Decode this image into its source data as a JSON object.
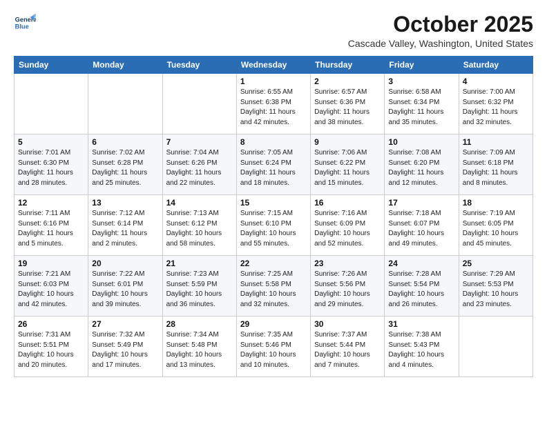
{
  "header": {
    "logo_line1": "General",
    "logo_line2": "Blue",
    "month": "October 2025",
    "location": "Cascade Valley, Washington, United States"
  },
  "weekdays": [
    "Sunday",
    "Monday",
    "Tuesday",
    "Wednesday",
    "Thursday",
    "Friday",
    "Saturday"
  ],
  "weeks": [
    [
      {
        "day": "",
        "text": ""
      },
      {
        "day": "",
        "text": ""
      },
      {
        "day": "",
        "text": ""
      },
      {
        "day": "1",
        "text": "Sunrise: 6:55 AM\nSunset: 6:38 PM\nDaylight: 11 hours\nand 42 minutes."
      },
      {
        "day": "2",
        "text": "Sunrise: 6:57 AM\nSunset: 6:36 PM\nDaylight: 11 hours\nand 38 minutes."
      },
      {
        "day": "3",
        "text": "Sunrise: 6:58 AM\nSunset: 6:34 PM\nDaylight: 11 hours\nand 35 minutes."
      },
      {
        "day": "4",
        "text": "Sunrise: 7:00 AM\nSunset: 6:32 PM\nDaylight: 11 hours\nand 32 minutes."
      }
    ],
    [
      {
        "day": "5",
        "text": "Sunrise: 7:01 AM\nSunset: 6:30 PM\nDaylight: 11 hours\nand 28 minutes."
      },
      {
        "day": "6",
        "text": "Sunrise: 7:02 AM\nSunset: 6:28 PM\nDaylight: 11 hours\nand 25 minutes."
      },
      {
        "day": "7",
        "text": "Sunrise: 7:04 AM\nSunset: 6:26 PM\nDaylight: 11 hours\nand 22 minutes."
      },
      {
        "day": "8",
        "text": "Sunrise: 7:05 AM\nSunset: 6:24 PM\nDaylight: 11 hours\nand 18 minutes."
      },
      {
        "day": "9",
        "text": "Sunrise: 7:06 AM\nSunset: 6:22 PM\nDaylight: 11 hours\nand 15 minutes."
      },
      {
        "day": "10",
        "text": "Sunrise: 7:08 AM\nSunset: 6:20 PM\nDaylight: 11 hours\nand 12 minutes."
      },
      {
        "day": "11",
        "text": "Sunrise: 7:09 AM\nSunset: 6:18 PM\nDaylight: 11 hours\nand 8 minutes."
      }
    ],
    [
      {
        "day": "12",
        "text": "Sunrise: 7:11 AM\nSunset: 6:16 PM\nDaylight: 11 hours\nand 5 minutes."
      },
      {
        "day": "13",
        "text": "Sunrise: 7:12 AM\nSunset: 6:14 PM\nDaylight: 11 hours\nand 2 minutes."
      },
      {
        "day": "14",
        "text": "Sunrise: 7:13 AM\nSunset: 6:12 PM\nDaylight: 10 hours\nand 58 minutes."
      },
      {
        "day": "15",
        "text": "Sunrise: 7:15 AM\nSunset: 6:10 PM\nDaylight: 10 hours\nand 55 minutes."
      },
      {
        "day": "16",
        "text": "Sunrise: 7:16 AM\nSunset: 6:09 PM\nDaylight: 10 hours\nand 52 minutes."
      },
      {
        "day": "17",
        "text": "Sunrise: 7:18 AM\nSunset: 6:07 PM\nDaylight: 10 hours\nand 49 minutes."
      },
      {
        "day": "18",
        "text": "Sunrise: 7:19 AM\nSunset: 6:05 PM\nDaylight: 10 hours\nand 45 minutes."
      }
    ],
    [
      {
        "day": "19",
        "text": "Sunrise: 7:21 AM\nSunset: 6:03 PM\nDaylight: 10 hours\nand 42 minutes."
      },
      {
        "day": "20",
        "text": "Sunrise: 7:22 AM\nSunset: 6:01 PM\nDaylight: 10 hours\nand 39 minutes."
      },
      {
        "day": "21",
        "text": "Sunrise: 7:23 AM\nSunset: 5:59 PM\nDaylight: 10 hours\nand 36 minutes."
      },
      {
        "day": "22",
        "text": "Sunrise: 7:25 AM\nSunset: 5:58 PM\nDaylight: 10 hours\nand 32 minutes."
      },
      {
        "day": "23",
        "text": "Sunrise: 7:26 AM\nSunset: 5:56 PM\nDaylight: 10 hours\nand 29 minutes."
      },
      {
        "day": "24",
        "text": "Sunrise: 7:28 AM\nSunset: 5:54 PM\nDaylight: 10 hours\nand 26 minutes."
      },
      {
        "day": "25",
        "text": "Sunrise: 7:29 AM\nSunset: 5:53 PM\nDaylight: 10 hours\nand 23 minutes."
      }
    ],
    [
      {
        "day": "26",
        "text": "Sunrise: 7:31 AM\nSunset: 5:51 PM\nDaylight: 10 hours\nand 20 minutes."
      },
      {
        "day": "27",
        "text": "Sunrise: 7:32 AM\nSunset: 5:49 PM\nDaylight: 10 hours\nand 17 minutes."
      },
      {
        "day": "28",
        "text": "Sunrise: 7:34 AM\nSunset: 5:48 PM\nDaylight: 10 hours\nand 13 minutes."
      },
      {
        "day": "29",
        "text": "Sunrise: 7:35 AM\nSunset: 5:46 PM\nDaylight: 10 hours\nand 10 minutes."
      },
      {
        "day": "30",
        "text": "Sunrise: 7:37 AM\nSunset: 5:44 PM\nDaylight: 10 hours\nand 7 minutes."
      },
      {
        "day": "31",
        "text": "Sunrise: 7:38 AM\nSunset: 5:43 PM\nDaylight: 10 hours\nand 4 minutes."
      },
      {
        "day": "",
        "text": ""
      }
    ]
  ]
}
